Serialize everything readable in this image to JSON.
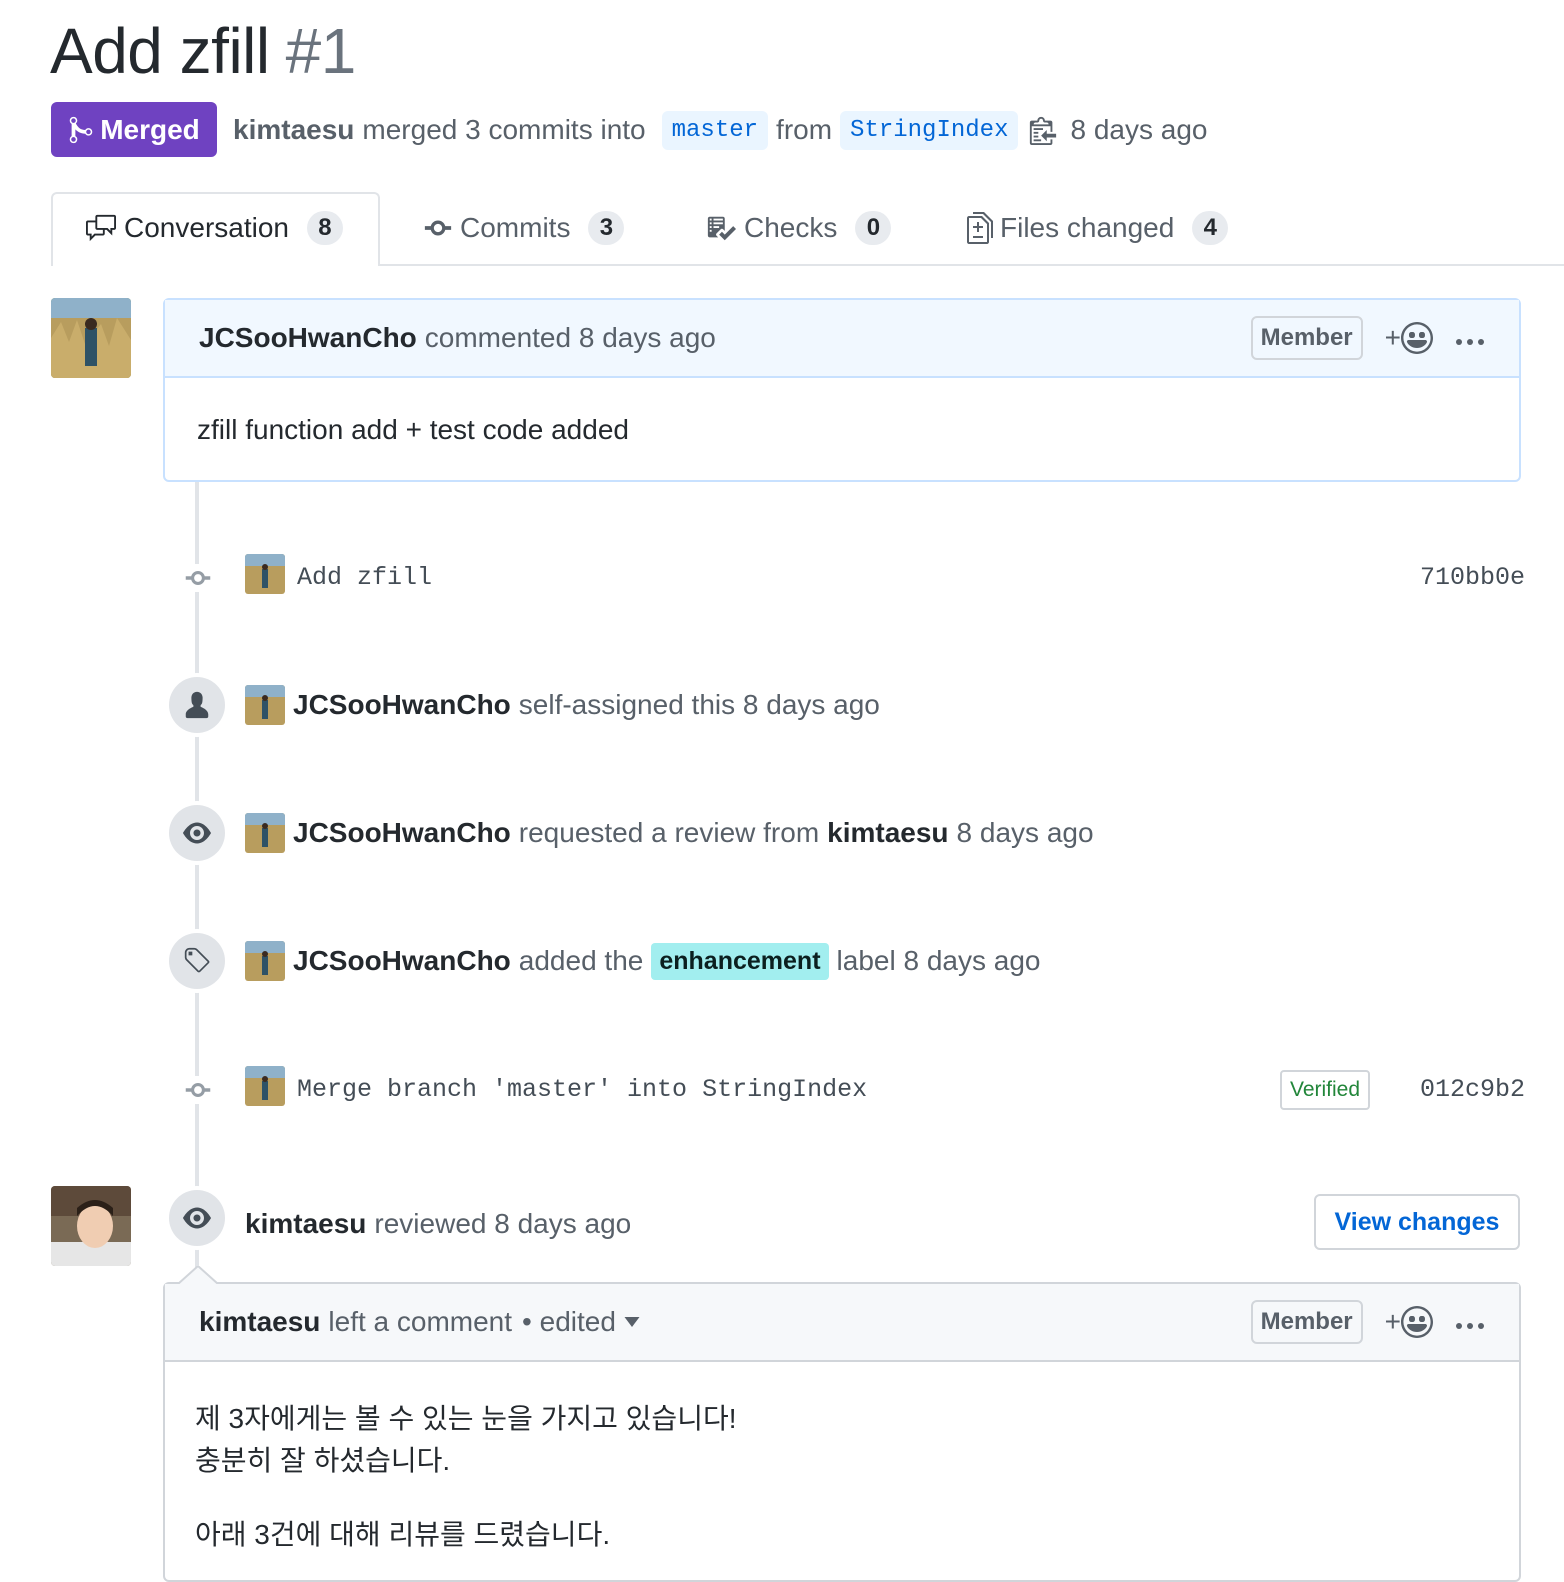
{
  "pr": {
    "title": "Add zfill",
    "number": "#1",
    "state": "Merged",
    "author": "kimtaesu",
    "merge_text_1": "merged 3 commits into",
    "base_branch": "master",
    "from_text": "from",
    "head_branch": "StringIndex",
    "time": "8 days ago"
  },
  "tabs": [
    {
      "label": "Conversation",
      "count": "8",
      "icon": "comment-discussion-icon",
      "active": true
    },
    {
      "label": "Commits",
      "count": "3",
      "icon": "git-commit-icon"
    },
    {
      "label": "Checks",
      "count": "0",
      "icon": "checklist-icon"
    },
    {
      "label": "Files changed",
      "count": "4",
      "icon": "file-diff-icon"
    }
  ],
  "first_comment": {
    "author": "JCSooHwanCho",
    "action": "commented 8 days ago",
    "role": "Member",
    "react_plus": "+",
    "body": "zfill function add + test code added"
  },
  "events": {
    "commit1": {
      "message": "Add zfill",
      "sha": "710bb0e"
    },
    "assign": {
      "actor": "JCSooHwanCho",
      "text": "self-assigned this 8 days ago"
    },
    "review_request": {
      "actor": "JCSooHwanCho",
      "text": "requested a review from",
      "reviewer": "kimtaesu",
      "time": "8 days ago"
    },
    "label": {
      "actor": "JCSooHwanCho",
      "text_before": "added the",
      "label": "enhancement",
      "text_after": "label 8 days ago",
      "label_color": "#a2eeef"
    },
    "commit2": {
      "message": "Merge branch 'master' into StringIndex",
      "verified": "Verified",
      "sha": "012c9b2"
    },
    "review": {
      "actor": "kimtaesu",
      "text": "reviewed 8 days ago",
      "button": "View changes"
    }
  },
  "review_comment": {
    "author": "kimtaesu",
    "action": "left a comment",
    "edited": "• edited",
    "role": "Member",
    "react_plus": "+",
    "body_line_1": "제 3자에게는 볼 수 있는 눈을 가지고 있습니다!",
    "body_line_2": "충분히 잘 하셨습니다.",
    "body_line_3": "아래 3건에 대해 리뷰를 드렸습니다."
  },
  "colors": {
    "merged": "#6f42c1",
    "link": "#0366d6",
    "verified": "#22863a"
  }
}
